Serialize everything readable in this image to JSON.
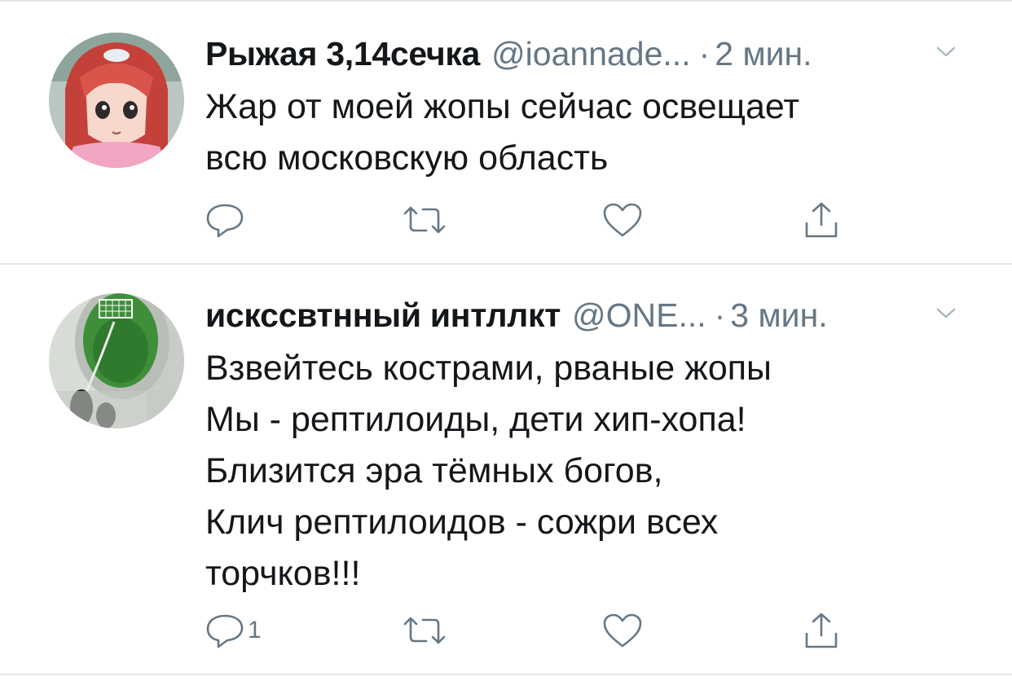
{
  "tweets": [
    {
      "name": "Рыжая 3,14сечка",
      "handle": "@ioannade...",
      "dot": "·",
      "time": "2 мин.",
      "lines": [
        "Жар от моей жопы сейчас освещает",
        "всю московскую область"
      ],
      "reply_count": "",
      "avatar_icon": "anime-girl-avatar"
    },
    {
      "name": "искссвтнный интллкт",
      "handle": "@ONE...",
      "dot": "·",
      "time": "3 мин.",
      "lines": [
        "Взвейтесь кострами, рваные жопы",
        "Мы - рептилоиды, дети хип-хопа!",
        "Близится эра тёмных богов,",
        "Клич рептилоидов - сожри всех",
        "торчков!!!"
      ],
      "reply_count": "1",
      "avatar_icon": "urinal-goal-avatar"
    }
  ],
  "icons": {
    "reply": "reply-icon",
    "retweet": "retweet-icon",
    "like": "heart-icon",
    "share": "share-icon",
    "menu": "chevron-down-icon"
  },
  "colors": {
    "text": "#14171a",
    "secondary": "#657786",
    "divider": "#e1e8ed"
  }
}
